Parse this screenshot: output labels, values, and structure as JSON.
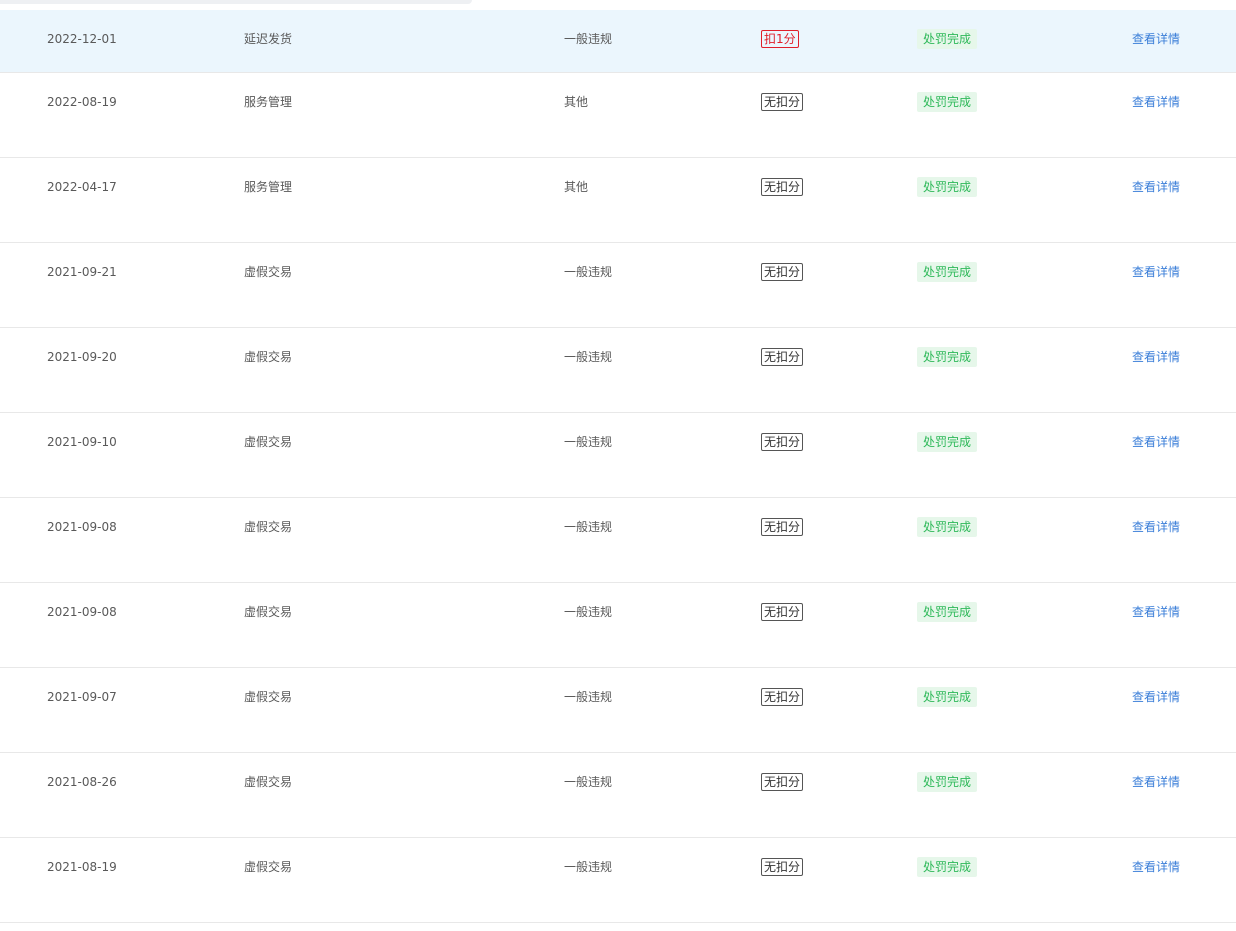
{
  "colors": {
    "highlight_row": "#ebf6fd",
    "deduct_red": "#e0202b",
    "status_green": "#2fb95a",
    "status_green_bg": "#e6f7ea",
    "link_blue": "#3a7ed8"
  },
  "rows": [
    {
      "date": "2022-12-01",
      "type": "延迟发货",
      "level": "一般违规",
      "score": "扣1分",
      "status": "处罚完成",
      "action": "查看详情"
    },
    {
      "date": "2022-08-19",
      "type": "服务管理",
      "level": "其他",
      "score": "无扣分",
      "status": "处罚完成",
      "action": "查看详情"
    },
    {
      "date": "2022-04-17",
      "type": "服务管理",
      "level": "其他",
      "score": "无扣分",
      "status": "处罚完成",
      "action": "查看详情"
    },
    {
      "date": "2021-09-21",
      "type": "虚假交易",
      "level": "一般违规",
      "score": "无扣分",
      "status": "处罚完成",
      "action": "查看详情"
    },
    {
      "date": "2021-09-20",
      "type": "虚假交易",
      "level": "一般违规",
      "score": "无扣分",
      "status": "处罚完成",
      "action": "查看详情"
    },
    {
      "date": "2021-09-10",
      "type": "虚假交易",
      "level": "一般违规",
      "score": "无扣分",
      "status": "处罚完成",
      "action": "查看详情"
    },
    {
      "date": "2021-09-08",
      "type": "虚假交易",
      "level": "一般违规",
      "score": "无扣分",
      "status": "处罚完成",
      "action": "查看详情"
    },
    {
      "date": "2021-09-08",
      "type": "虚假交易",
      "level": "一般违规",
      "score": "无扣分",
      "status": "处罚完成",
      "action": "查看详情"
    },
    {
      "date": "2021-09-07",
      "type": "虚假交易",
      "level": "一般违规",
      "score": "无扣分",
      "status": "处罚完成",
      "action": "查看详情"
    },
    {
      "date": "2021-08-26",
      "type": "虚假交易",
      "level": "一般违规",
      "score": "无扣分",
      "status": "处罚完成",
      "action": "查看详情"
    },
    {
      "date": "2021-08-19",
      "type": "虚假交易",
      "level": "一般违规",
      "score": "无扣分",
      "status": "处罚完成",
      "action": "查看详情"
    }
  ]
}
